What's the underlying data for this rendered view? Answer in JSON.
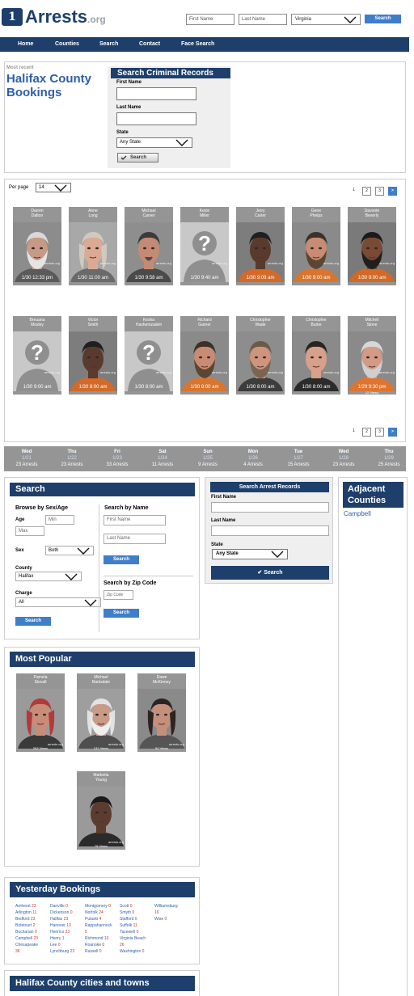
{
  "header": {
    "logo_mark": "1",
    "logo_name": "Arrests",
    "logo_tld": ".org",
    "first_name_placeholder": "First Name",
    "last_name_placeholder": "Last Name",
    "state_value": "Virginia",
    "search_label": "Search"
  },
  "nav": [
    "Home",
    "Counties",
    "Search",
    "Contact",
    "Face Search"
  ],
  "intro": {
    "kicker": "Most recent",
    "title_line1": "Halifax County",
    "title_line2": "Bookings"
  },
  "criminal_search": {
    "title": "Search Criminal Records",
    "first_label": "First Name",
    "last_label": "Last Name",
    "state_label": "State",
    "state_value": "Any State",
    "button": "Search"
  },
  "listing": {
    "per_page_label": "Per page",
    "per_page_value": "14",
    "pages": [
      "1",
      "2",
      "3",
      ">"
    ],
    "watermark": "arrests.org",
    "row1": [
      {
        "name": "Darren\nDalton",
        "time": "1/30 12:33 pm",
        "photo": "beard-gray",
        "views": ""
      },
      {
        "name": "Anne\nLong",
        "time": "1/30 11:00 am",
        "photo": "woman-gray",
        "views": ""
      },
      {
        "name": "Michael\nCarver",
        "time": "1/30 9:58 am",
        "photo": "man-goatee",
        "views": ""
      },
      {
        "name": "Kevin\nMiller",
        "time": "1/30 9:40 am",
        "photo": "silhouette",
        "views": ""
      },
      {
        "name": "Jerry\nCarter",
        "time": "1/30 9:09 am",
        "photo": "man-dark",
        "views": ""
      },
      {
        "name": "Gene\nPhelps",
        "time": "1/30 9:00 am",
        "photo": "man-orange",
        "views": ""
      },
      {
        "name": "Davonte\nBeverly",
        "time": "1/30 9:00 am",
        "photo": "man-dark-beard",
        "views": ""
      }
    ],
    "row2": [
      {
        "name": "Breuana\nMosley",
        "time": "1/30 9:00 am",
        "photo": "silhouette",
        "views": ""
      },
      {
        "name": "Victor\nSmith",
        "time": "1/30 8:00 am",
        "photo": "man-dark",
        "views": ""
      },
      {
        "name": "Kesha\nHashemzadeh",
        "time": "1/30 8:00 am",
        "photo": "silhouette",
        "views": ""
      },
      {
        "name": "Richard\nGarner",
        "time": "1/30 8:00 am",
        "photo": "man-orange",
        "views": ""
      },
      {
        "name": "Christopher\nWade",
        "time": "1/30 8:00 am",
        "photo": "man-light",
        "views": ""
      },
      {
        "name": "Christopher\nBurke",
        "time": "1/30 8:00 am",
        "photo": "man-young",
        "views": ""
      },
      {
        "name": "Mitchell\nStone",
        "time": "1/29 9:30 pm",
        "photo": "man-orange-older",
        "views": "12 Views"
      }
    ]
  },
  "week": [
    {
      "day": "Wed",
      "date": "1/21",
      "count": "23 Arrests"
    },
    {
      "day": "Thu",
      "date": "1/22",
      "count": "23 Arrests"
    },
    {
      "day": "Fri",
      "date": "1/23",
      "count": "33 Arrests"
    },
    {
      "day": "Sat",
      "date": "1/24",
      "count": "11 Arrests"
    },
    {
      "day": "Sun",
      "date": "1/25",
      "count": "9 Arrests"
    },
    {
      "day": "Mon",
      "date": "1/26",
      "count": "4 Arrests"
    },
    {
      "day": "Tue",
      "date": "1/27",
      "count": "15 Arrests"
    },
    {
      "day": "Wed",
      "date": "1/28",
      "count": "23 Arrests"
    },
    {
      "day": "Thu",
      "date": "1/29",
      "count": "25 Arrests"
    }
  ],
  "search_panel": {
    "title": "Search",
    "browse_title": "Browse by Sex/Age",
    "age_label": "Age",
    "min_placeholder": "Min",
    "max_placeholder": "Max",
    "sex_label": "Sex",
    "sex_value": "Both",
    "county_label": "County",
    "county_value": "Halifax",
    "charge_label": "Charge",
    "charge_value": "All",
    "browse_button": "Search",
    "name_title": "Search by Name",
    "first_placeholder": "First Name",
    "last_placeholder": "Last Name",
    "name_button": "Search",
    "zip_title": "Search by Zip Code",
    "zip_placeholder": "Zip Code",
    "zip_button": "Search"
  },
  "arrest_records": {
    "title": "Search Arrest Records",
    "first_label": "First Name",
    "last_label": "Last Name",
    "state_label": "State",
    "state_value": "Any State",
    "button": "✔ Search"
  },
  "adjacent": {
    "title_line1": "Adjacent",
    "title_line2": "Counties",
    "items": [
      "Campbell"
    ]
  },
  "popular": {
    "title": "Most Popular",
    "items": [
      {
        "name": "Pamela\nStovall",
        "views": "263 Views",
        "photo": "woman-red"
      },
      {
        "name": "Michael\nBarksdale",
        "views": "131 Views",
        "photo": "beard-white"
      },
      {
        "name": "Dawn\nMcKinney",
        "views": "94 Views",
        "photo": "woman-dark"
      },
      {
        "name": "Markeita\nYoung",
        "views": "75 Views",
        "photo": "woman-young"
      }
    ]
  },
  "yesterday": {
    "title": "Yesterday Bookings",
    "columns": [
      [
        [
          "Amherst",
          "23"
        ],
        [
          "Arlington",
          "11"
        ],
        [
          "Bedford",
          "23"
        ],
        [
          "Botetourt",
          "2"
        ],
        [
          "Buchanan",
          "0"
        ],
        [
          "Campbell",
          "23"
        ],
        [
          "Chesapeake",
          ""
        ],
        [
          "",
          "36"
        ]
      ],
      [
        [
          "Danville",
          "0"
        ],
        [
          "Dickenson",
          "0"
        ],
        [
          "Halifax",
          "23"
        ],
        [
          "Hanover",
          "10"
        ],
        [
          "Henrico",
          "23"
        ],
        [
          "Henry",
          "1"
        ],
        [
          "Lee",
          "0"
        ],
        [
          "Lynchburg",
          "23"
        ]
      ],
      [
        [
          "Montgomery",
          "0"
        ],
        [
          "Norfolk",
          "24"
        ],
        [
          "Pulaski",
          "4"
        ],
        [
          "Rappahannock",
          ""
        ],
        [
          "",
          "5"
        ],
        [
          "Richmond",
          "10"
        ],
        [
          "Roanoke",
          "0"
        ],
        [
          "Russell",
          "0"
        ]
      ],
      [
        [
          "Scott",
          "0"
        ],
        [
          "Smyth",
          "0"
        ],
        [
          "Stafford",
          "0"
        ],
        [
          "Suffolk",
          "11"
        ],
        [
          "Tazewell",
          "0"
        ],
        [
          "Virginia Beach",
          ""
        ],
        [
          "",
          "26"
        ],
        [
          "Washington",
          "0"
        ]
      ],
      [
        [
          "Williamsburg",
          ""
        ],
        [
          "",
          "16"
        ],
        [
          "Wise",
          "0"
        ]
      ]
    ]
  },
  "cities": {
    "title": "Halifax County cities and towns"
  },
  "colors": {
    "navy": "#1e3f6b",
    "button_blue": "#3f7ec9",
    "count_red": "#c0392b",
    "card_gray": "#959595"
  }
}
